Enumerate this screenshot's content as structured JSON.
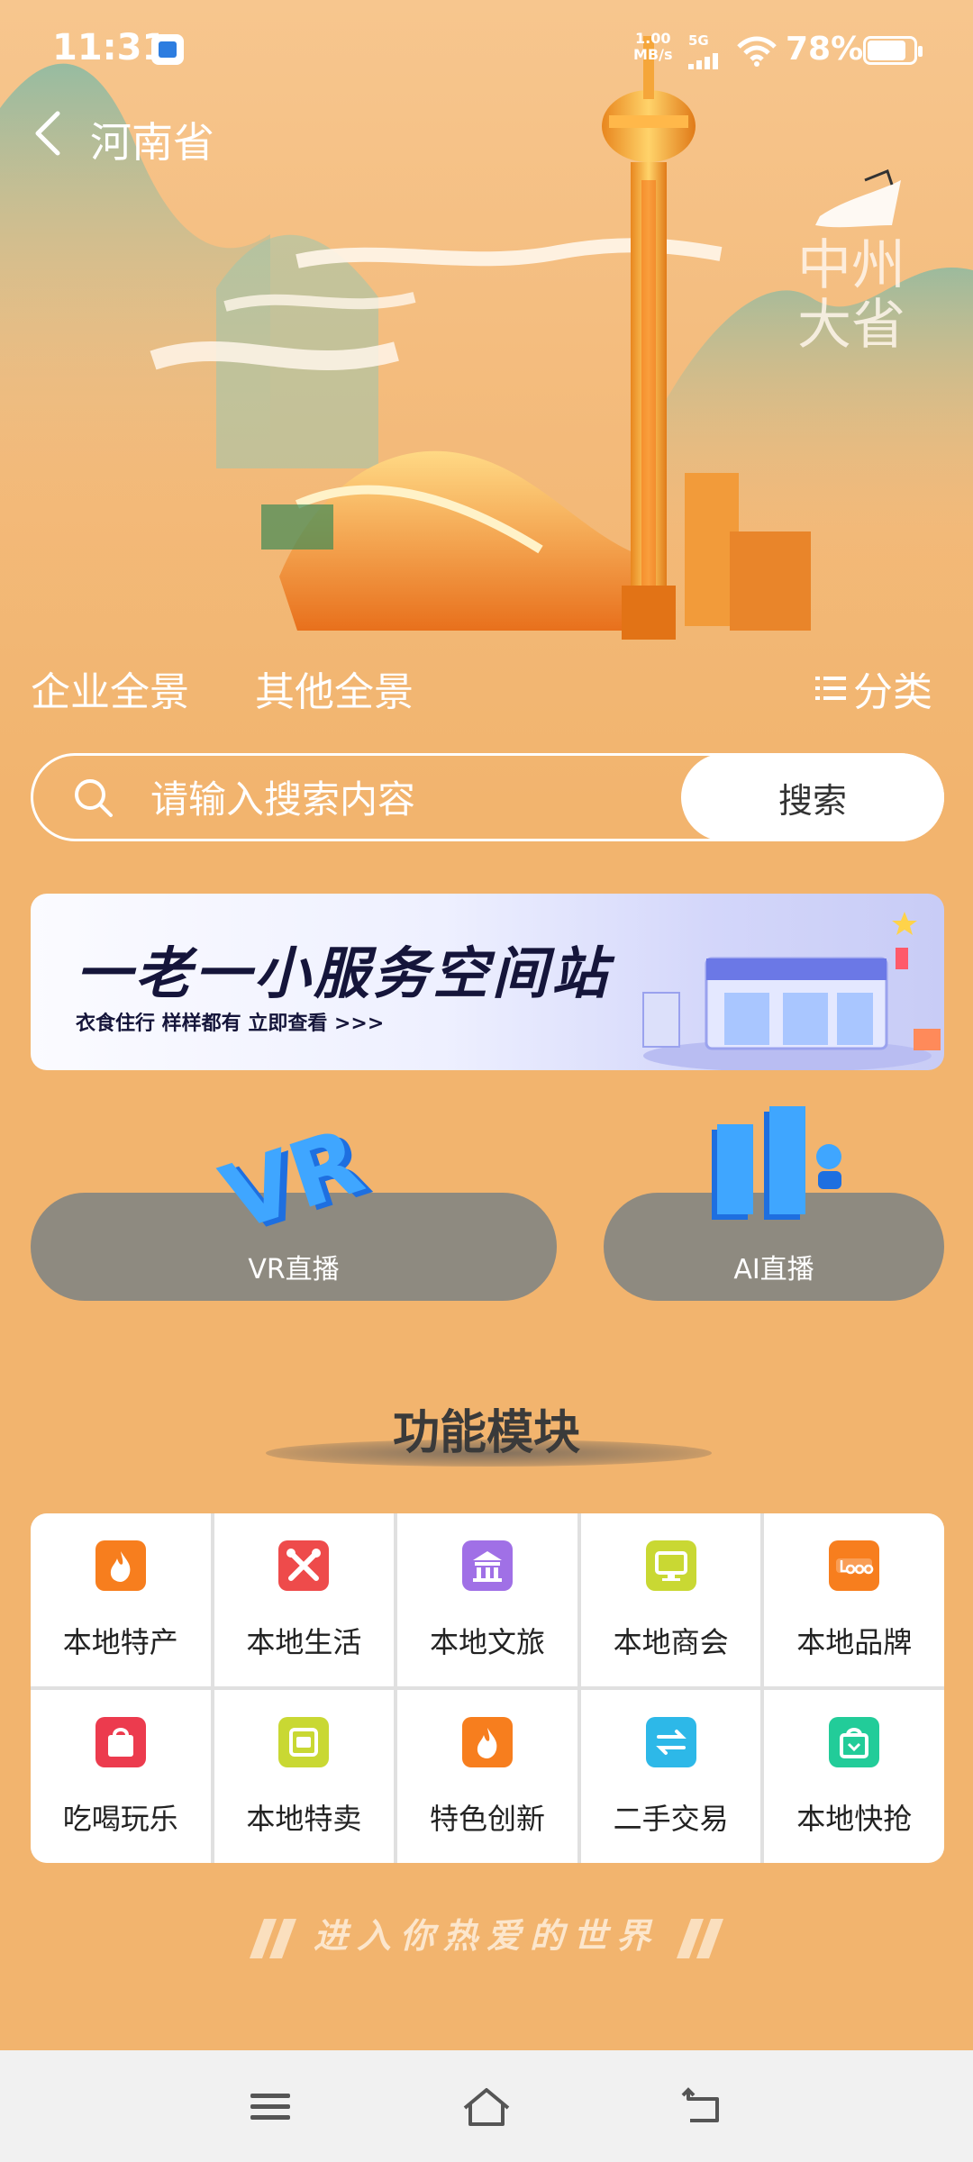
{
  "status_bar": {
    "time": "11:31",
    "net_speed_value": "1.00",
    "net_speed_unit": "MB/s",
    "network": "5G",
    "battery": "78%"
  },
  "header": {
    "title": "河南省",
    "calligraphy": "中州大省"
  },
  "tabs": {
    "enterprise": "企业全景",
    "other": "其他全景",
    "category": "分类"
  },
  "search": {
    "placeholder": "请输入搜索内容",
    "button": "搜索"
  },
  "promo": {
    "title": "一老一小服务空间站",
    "subtitle": "衣食住行 样样都有 立即查看 >>>"
  },
  "live": {
    "vr_label": "VR直播",
    "ai_label": "AI直播"
  },
  "section": {
    "title": "功能模块"
  },
  "modules": [
    {
      "label": "本地特产",
      "icon": "flame-icon",
      "color": "#F77E1E"
    },
    {
      "label": "本地生活",
      "icon": "tools-icon",
      "color": "#EE4B4B"
    },
    {
      "label": "本地文旅",
      "icon": "landmark-icon",
      "color": "#A070E6"
    },
    {
      "label": "本地商会",
      "icon": "monitor-icon",
      "color": "#C9D833"
    },
    {
      "label": "本地品牌",
      "icon": "logo-icon",
      "color": "#F77E1E"
    },
    {
      "label": "吃喝玩乐",
      "icon": "shopping-bag-icon",
      "color": "#EC3B4E"
    },
    {
      "label": "本地特卖",
      "icon": "sale-tag-icon",
      "color": "#C9D833"
    },
    {
      "label": "特色创新",
      "icon": "flame-icon",
      "color": "#F77E1E"
    },
    {
      "label": "二手交易",
      "icon": "exchange-icon",
      "color": "#2DB8E8"
    },
    {
      "label": "本地快抢",
      "icon": "quick-buy-bag-icon",
      "color": "#22CC99"
    }
  ],
  "slogan": "进入你热爱的世界",
  "colors": {
    "page_background": "#F2B46E",
    "search_button_bg": "#FFFFFF",
    "live_button_bg": "#8E8A80",
    "navbar_bg": "#F1F1F1"
  }
}
